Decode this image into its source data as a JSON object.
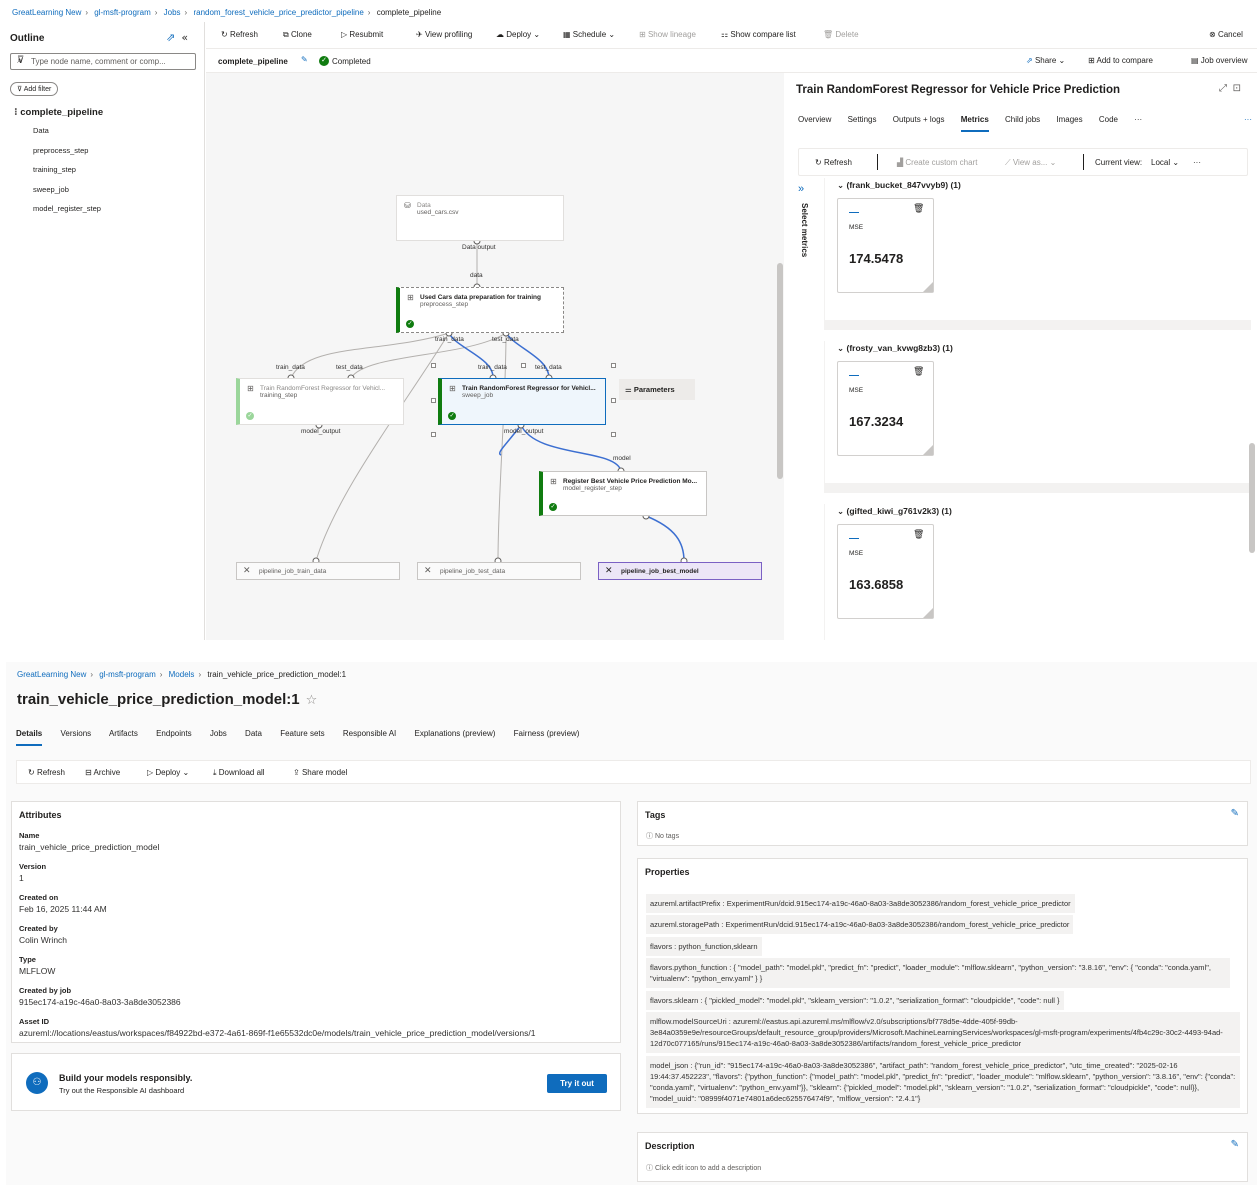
{
  "pipeline_view": {
    "breadcrumb": [
      "GreatLearning New",
      "gl-msft-program",
      "Jobs",
      "random_forest_vehicle_price_predictor_pipeline",
      "complete_pipeline"
    ],
    "outline": {
      "title": "Outline",
      "search_placeholder": "Type node name, comment or comp...",
      "add_filter": "Add filter",
      "root": "complete_pipeline",
      "items": [
        "Data",
        "preprocess_step",
        "training_step",
        "sweep_job",
        "model_register_step"
      ]
    },
    "toolbar": {
      "refresh": "Refresh",
      "clone": "Clone",
      "resubmit": "Resubmit",
      "view_profiling": "View profiling",
      "deploy": "Deploy",
      "schedule": "Schedule",
      "show_lineage": "Show lineage",
      "show_compare_list": "Show compare list",
      "delete": "Delete",
      "cancel": "Cancel"
    },
    "subbar": {
      "pipeline_name": "complete_pipeline",
      "status": "Completed",
      "share": "Share",
      "add_to_compare": "Add to compare",
      "job_overview": "Job overview"
    },
    "graph": {
      "data_node": {
        "title": "Data",
        "subtitle": "used_cars.csv",
        "port": "Data output"
      },
      "data_port_label": "data",
      "prep_node": {
        "title": "Used Cars data preparation for training",
        "subtitle": "preprocess_step"
      },
      "prep_outputs": [
        "train_data",
        "test_data"
      ],
      "train_node": {
        "title": "Train RandomForest Regressor for Vehicl...",
        "subtitle": "training_step",
        "inputs": [
          "train_data",
          "test_data"
        ],
        "output": "model_output"
      },
      "sweep_node": {
        "title": "Train RandomForest Regressor for Vehicl...",
        "subtitle": "sweep_job",
        "inputs": [
          "train_data",
          "test_data"
        ],
        "output": "model_output"
      },
      "parameters_label": "Parameters",
      "register_node": {
        "title": "Register Best Vehicle Price Prediction Mo...",
        "subtitle": "model_register_step",
        "input": "model"
      },
      "outputs": [
        "pipeline_job_train_data",
        "pipeline_job_test_data",
        "pipeline_job_best_model"
      ]
    },
    "panel": {
      "title": "Train RandomForest Regressor for Vehicle Price Prediction",
      "tabs": [
        "Overview",
        "Settings",
        "Outputs + logs",
        "Metrics",
        "Child jobs",
        "Images",
        "Code",
        "···"
      ],
      "selected_tab": "Metrics",
      "metrics_toolbar": {
        "refresh": "Refresh",
        "create_chart": "Create custom chart",
        "view_as": "View as...",
        "current_view": "Current view:",
        "view_value": "Local"
      },
      "select_metrics": "Select metrics",
      "groups": [
        {
          "name": "(frank_bucket_847vvyb9) (1)",
          "metric": "MSE",
          "value": "174.5478"
        },
        {
          "name": "(frosty_van_kvwg8zb3) (1)",
          "metric": "MSE",
          "value": "167.3234"
        },
        {
          "name": "(gifted_kiwi_g761v2k3) (1)",
          "metric": "MSE",
          "value": "163.6858"
        }
      ]
    }
  },
  "model_view": {
    "breadcrumb": [
      "GreatLearning New",
      "gl-msft-program",
      "Models",
      "train_vehicle_price_prediction_model:1"
    ],
    "title": "train_vehicle_price_prediction_model:1",
    "tabs": [
      "Details",
      "Versions",
      "Artifacts",
      "Endpoints",
      "Jobs",
      "Data",
      "Feature sets",
      "Responsible AI",
      "Explanations (preview)",
      "Fairness (preview)"
    ],
    "toolbar": {
      "refresh": "Refresh",
      "archive": "Archive",
      "deploy": "Deploy",
      "download_all": "Download all",
      "share_model": "Share model"
    },
    "attributes_title": "Attributes",
    "attributes": [
      {
        "key": "Name",
        "value": "train_vehicle_price_prediction_model"
      },
      {
        "key": "Version",
        "value": "1"
      },
      {
        "key": "Created on",
        "value": "Feb 16, 2025 11:44 AM"
      },
      {
        "key": "Created by",
        "value": "Colin Wrinch"
      },
      {
        "key": "Type",
        "value": "MLFLOW"
      },
      {
        "key": "Created by job",
        "value": "915ec174-a19c-46a0-8a03-3a8de3052386"
      },
      {
        "key": "Asset ID",
        "value": "azureml://locations/eastus/workspaces/f84922bd-e372-4a61-869f-f1e65532dc0e/models/train_vehicle_price_prediction_model/versions/1"
      }
    ],
    "responsible": {
      "title": "Build your models responsibly.",
      "subtitle": "Try out the Responsible AI dashboard",
      "button": "Try it out"
    },
    "tags_title": "Tags",
    "tags_empty": "No tags",
    "properties_title": "Properties",
    "properties": [
      "azureml.artifactPrefix : ExperimentRun/dcid.915ec174-a19c-46a0-8a03-3a8de3052386/random_forest_vehicle_price_predictor",
      "azureml.storagePath : ExperimentRun/dcid.915ec174-a19c-46a0-8a03-3a8de3052386/random_forest_vehicle_price_predictor",
      "flavors : python_function,sklearn",
      "flavors.python_function : { \"model_path\": \"model.pkl\", \"predict_fn\": \"predict\", \"loader_module\": \"mlflow.sklearn\", \"python_version\": \"3.8.16\", \"env\": { \"conda\": \"conda.yaml\", \"virtualenv\": \"python_env.yaml\" } }",
      "flavors.sklearn : { \"pickled_model\": \"model.pkl\", \"sklearn_version\": \"1.0.2\", \"serialization_format\": \"cloudpickle\", \"code\": null }",
      "mlflow.modelSourceUri : azureml://eastus.api.azureml.ms/mlflow/v2.0/subscriptions/bf778d5e-4dde-405f-99db-3e84a0359e9e/resourceGroups/default_resource_group/providers/Microsoft.MachineLearningServices/workspaces/gl-msft-program/experiments/4fb4c29c-30c2-4493-94ad-12d70c077165/runs/915ec174-a19c-46a0-8a03-3a8de3052386/artifacts/random_forest_vehicle_price_predictor",
      "model_json : {\"run_id\": \"915ec174-a19c-46a0-8a03-3a8de3052386\", \"artifact_path\": \"random_forest_vehicle_price_predictor\", \"utc_time_created\": \"2025-02-16 19:44:37.452223\", \"flavors\": {\"python_function\": {\"model_path\": \"model.pkl\", \"predict_fn\": \"predict\", \"loader_module\": \"mlflow.sklearn\", \"python_version\": \"3.8.16\", \"env\": {\"conda\": \"conda.yaml\", \"virtualenv\": \"python_env.yaml\"}}, \"sklearn\": {\"pickled_model\": \"model.pkl\", \"sklearn_version\": \"1.0.2\", \"serialization_format\": \"cloudpickle\", \"code\": null}}, \"model_uuid\": \"08999f4071e74801a6dec625576474f9\", \"mlflow_version\": \"2.4.1\"}"
    ],
    "description_title": "Description",
    "description_hint": "Click edit icon to add a description"
  }
}
